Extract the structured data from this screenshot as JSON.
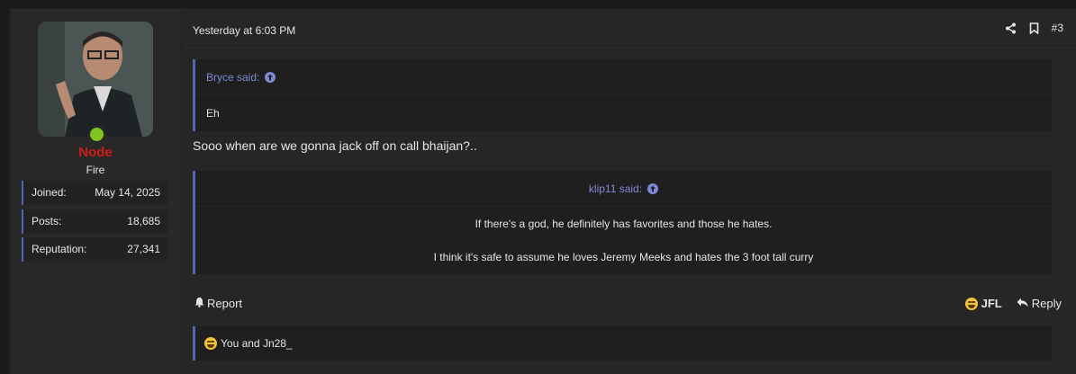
{
  "user": {
    "name": "Node",
    "title": "Fire",
    "online": true,
    "stats": [
      {
        "label": "Joined:",
        "value": "May 14, 2025"
      },
      {
        "label": "Posts:",
        "value": "18,685"
      },
      {
        "label": "Reputation:",
        "value": "27,341"
      }
    ]
  },
  "post": {
    "date": "Yesterday at 6:03 PM",
    "number": "#3",
    "quote1": {
      "author": "Bryce said:",
      "text": "Eh"
    },
    "text": "Sooo when are we gonna jack off on call bhaijan?..",
    "quote2": {
      "author": "klip11 said:",
      "line1": "If there's a god, he definitely has favorites and those he hates.",
      "line2": "I think it's safe to assume he loves Jeremy Meeks and hates the 3 foot tall curry"
    }
  },
  "actions": {
    "report": "Report",
    "reaction": "JFL",
    "reply": "Reply"
  },
  "reactions_summary": "You and Jn28_",
  "colors": {
    "username": "#d41b1b",
    "accent": "#5865b0",
    "link": "#7e8ad4",
    "online": "#7fc31f"
  }
}
